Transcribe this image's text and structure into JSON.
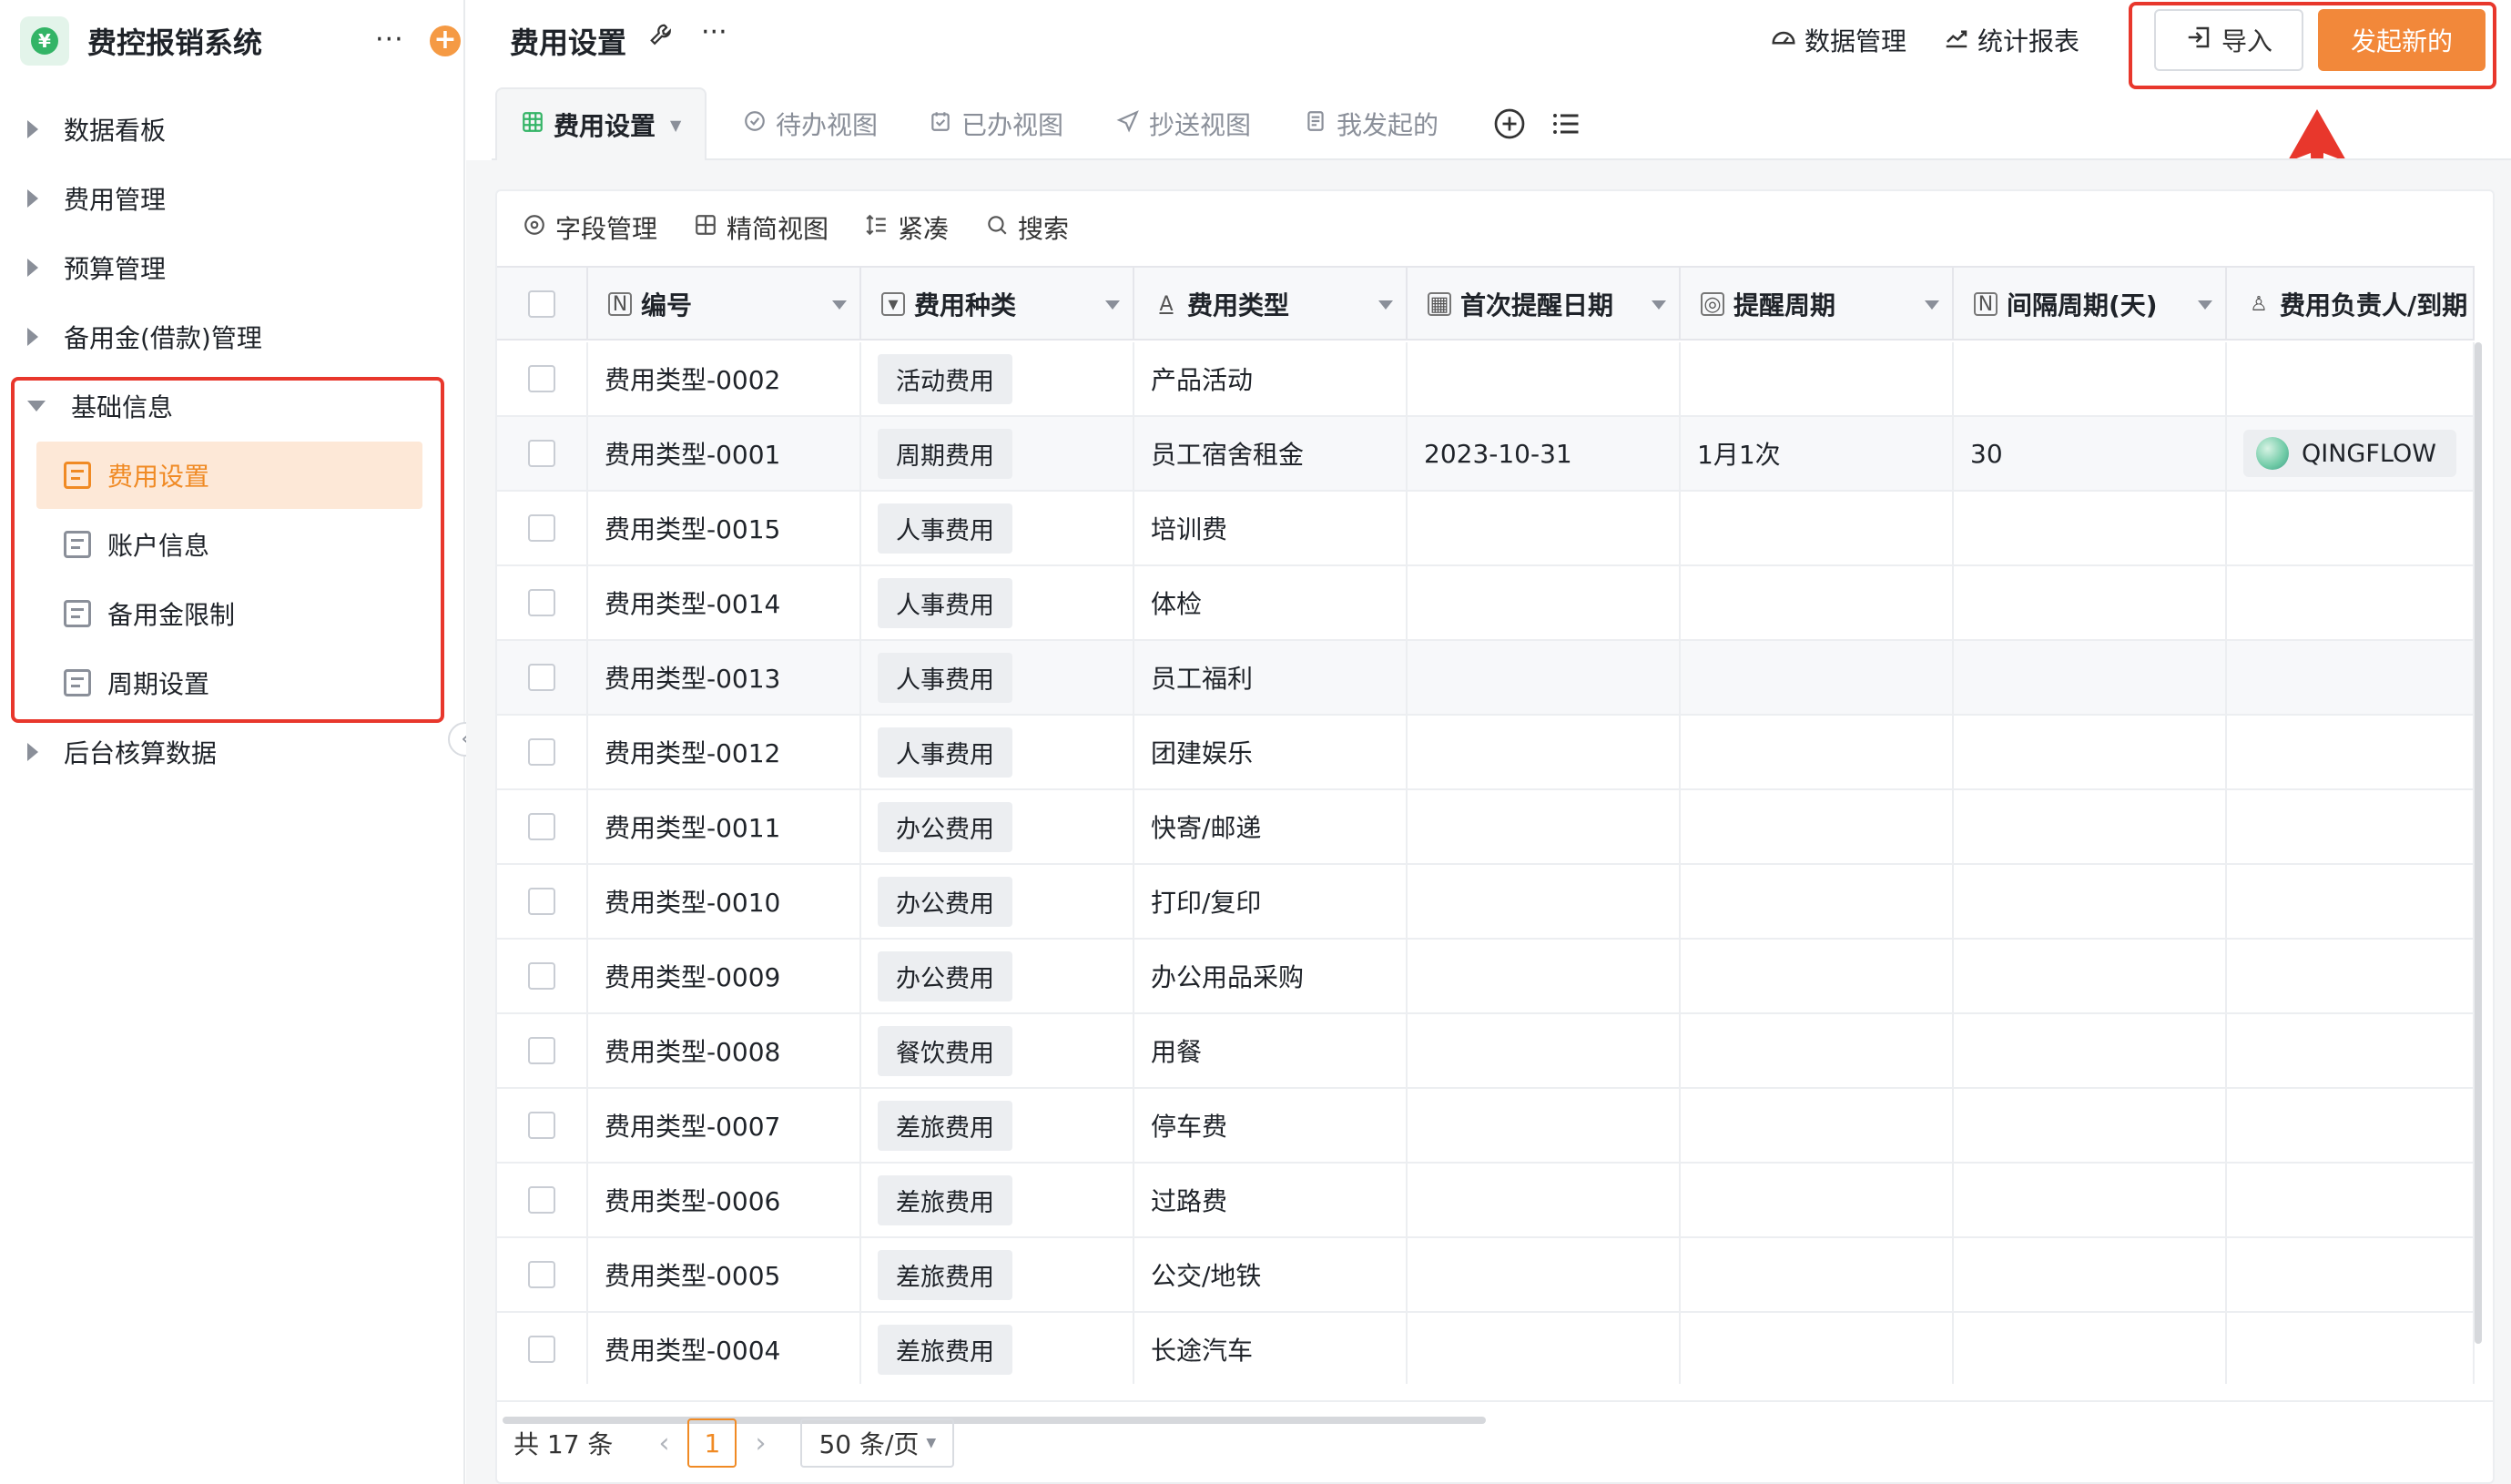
{
  "app": {
    "title": "费控报销系统",
    "logo_symbol": "¥",
    "more": "···",
    "add": "+"
  },
  "sidebar": {
    "items": [
      {
        "label": "数据看板"
      },
      {
        "label": "费用管理"
      },
      {
        "label": "预算管理"
      },
      {
        "label": "备用金(借款)管理"
      },
      {
        "label": "基础信息"
      },
      {
        "label": "后台核算数据"
      }
    ],
    "sub_items": [
      {
        "label": "费用设置"
      },
      {
        "label": "账户信息"
      },
      {
        "label": "备用金限制"
      },
      {
        "label": "周期设置"
      }
    ],
    "collapse_glyph": "‹"
  },
  "header": {
    "title": "费用设置",
    "more": "···",
    "data_manage": "数据管理",
    "stats_report": "统计报表",
    "import_label": "导入",
    "launch_label": "发起新的"
  },
  "tabs": [
    {
      "label": "费用设置",
      "icon": "grid-icon"
    },
    {
      "label": "待办视图",
      "icon": "check-circle-icon"
    },
    {
      "label": "已办视图",
      "icon": "calendar-check-icon"
    },
    {
      "label": "抄送视图",
      "icon": "send-icon"
    },
    {
      "label": "我发起的",
      "icon": "document-icon"
    }
  ],
  "toolbar": {
    "field_manage": "字段管理",
    "simple_view": "精简视图",
    "compact": "紧凑",
    "search": "搜索"
  },
  "table": {
    "columns": [
      {
        "label": "编号",
        "icon": "N"
      },
      {
        "label": "费用种类",
        "icon": "▾"
      },
      {
        "label": "费用类型",
        "icon": "A"
      },
      {
        "label": "首次提醒日期",
        "icon": "▦"
      },
      {
        "label": "提醒周期",
        "icon": "◎"
      },
      {
        "label": "间隔周期(天)",
        "icon": "N"
      },
      {
        "label": "费用负责人/到期",
        "icon": "♙"
      }
    ],
    "rows": [
      {
        "id": "费用类型-0002",
        "kind": "活动费用",
        "type": "产品活动",
        "first_date": "",
        "period": "",
        "interval": "",
        "owner": ""
      },
      {
        "id": "费用类型-0001",
        "kind": "周期费用",
        "type": "员工宿舍租金",
        "first_date": "2023-10-31",
        "period": "1月1次",
        "interval": "30",
        "owner": "QINGFLOW"
      },
      {
        "id": "费用类型-0015",
        "kind": "人事费用",
        "type": "培训费",
        "first_date": "",
        "period": "",
        "interval": "",
        "owner": ""
      },
      {
        "id": "费用类型-0014",
        "kind": "人事费用",
        "type": "体检",
        "first_date": "",
        "period": "",
        "interval": "",
        "owner": ""
      },
      {
        "id": "费用类型-0013",
        "kind": "人事费用",
        "type": "员工福利",
        "first_date": "",
        "period": "",
        "interval": "",
        "owner": ""
      },
      {
        "id": "费用类型-0012",
        "kind": "人事费用",
        "type": "团建娱乐",
        "first_date": "",
        "period": "",
        "interval": "",
        "owner": ""
      },
      {
        "id": "费用类型-0011",
        "kind": "办公费用",
        "type": "快寄/邮递",
        "first_date": "",
        "period": "",
        "interval": "",
        "owner": ""
      },
      {
        "id": "费用类型-0010",
        "kind": "办公费用",
        "type": "打印/复印",
        "first_date": "",
        "period": "",
        "interval": "",
        "owner": ""
      },
      {
        "id": "费用类型-0009",
        "kind": "办公费用",
        "type": "办公用品采购",
        "first_date": "",
        "period": "",
        "interval": "",
        "owner": ""
      },
      {
        "id": "费用类型-0008",
        "kind": "餐饮费用",
        "type": "用餐",
        "first_date": "",
        "period": "",
        "interval": "",
        "owner": ""
      },
      {
        "id": "费用类型-0007",
        "kind": "差旅费用",
        "type": "停车费",
        "first_date": "",
        "period": "",
        "interval": "",
        "owner": ""
      },
      {
        "id": "费用类型-0006",
        "kind": "差旅费用",
        "type": "过路费",
        "first_date": "",
        "period": "",
        "interval": "",
        "owner": ""
      },
      {
        "id": "费用类型-0005",
        "kind": "差旅费用",
        "type": "公交/地铁",
        "first_date": "",
        "period": "",
        "interval": "",
        "owner": ""
      },
      {
        "id": "费用类型-0004",
        "kind": "差旅费用",
        "type": "长途汽车",
        "first_date": "",
        "period": "",
        "interval": "",
        "owner": ""
      }
    ]
  },
  "pager": {
    "total": "共 17 条",
    "prev": "‹",
    "page": "1",
    "next": "›",
    "page_size": "50 条/页"
  },
  "colors": {
    "accent": "#f2883a",
    "highlight_red": "#e8372c",
    "active_bg": "#fde8d7"
  }
}
